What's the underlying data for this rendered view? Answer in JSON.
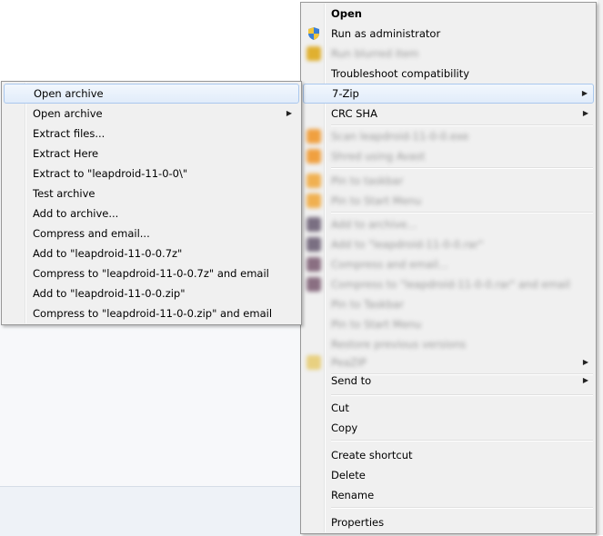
{
  "main_menu": {
    "items": [
      {
        "label": "Open"
      },
      {
        "label": "Run as administrator",
        "icon": "uac-shield-icon"
      },
      {
        "label": "Run blurred item"
      },
      {
        "label": "Troubleshoot compatibility"
      },
      {
        "label": "7-Zip"
      },
      {
        "label": "CRC SHA"
      },
      {
        "label": "Scan leapdroid-11-0-0.exe"
      },
      {
        "label": "Shred using Avast"
      },
      {
        "label": "Pin to taskbar"
      },
      {
        "label": "Pin to Start Menu"
      },
      {
        "label": "Add to archive..."
      },
      {
        "label": "Add to \"leapdroid-11-0-0.rar\""
      },
      {
        "label": "Compress and email..."
      },
      {
        "label": "Compress to \"leapdroid-11-0-0.rar\" and email"
      },
      {
        "label": "Pin to Taskbar"
      },
      {
        "label": "Pin to Start Menu"
      },
      {
        "label": "Restore previous versions"
      },
      {
        "label": "PeaZIP"
      },
      {
        "label": "Send to"
      },
      {
        "label": "Cut"
      },
      {
        "label": "Copy"
      },
      {
        "label": "Create shortcut"
      },
      {
        "label": "Delete"
      },
      {
        "label": "Rename"
      },
      {
        "label": "Properties"
      }
    ]
  },
  "sub_menu": {
    "items": [
      {
        "label": "Open archive"
      },
      {
        "label": "Open archive"
      },
      {
        "label": "Extract files..."
      },
      {
        "label": "Extract Here"
      },
      {
        "label": "Extract to \"leapdroid-11-0-0\\\""
      },
      {
        "label": "Test archive"
      },
      {
        "label": "Add to archive..."
      },
      {
        "label": "Compress and email..."
      },
      {
        "label": "Add to \"leapdroid-11-0-0.7z\""
      },
      {
        "label": "Compress to \"leapdroid-11-0-0.7z\" and email"
      },
      {
        "label": "Add to \"leapdroid-11-0-0.zip\""
      },
      {
        "label": "Compress to \"leapdroid-11-0-0.zip\" and email"
      }
    ]
  },
  "submenu_arrow": "▶"
}
